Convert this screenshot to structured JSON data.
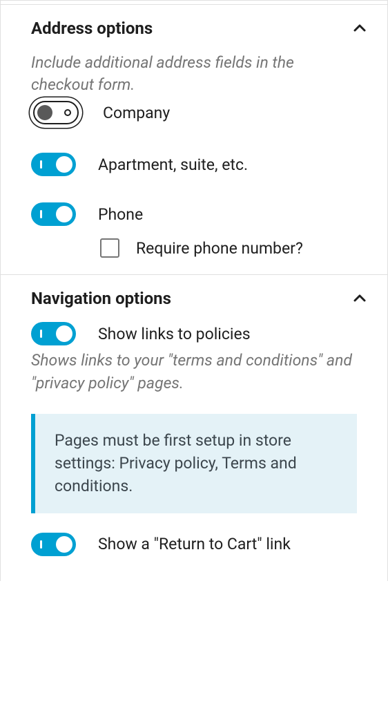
{
  "address_options": {
    "title": "Address options",
    "description": "Include additional address fields in the checkout form.",
    "company": {
      "label": "Company",
      "on": false
    },
    "apartment": {
      "label": "Apartment, suite, etc.",
      "on": true
    },
    "phone": {
      "label": "Phone",
      "on": true
    },
    "require_phone": {
      "label": "Require phone number?",
      "checked": false
    }
  },
  "navigation_options": {
    "title": "Navigation options",
    "policies": {
      "label": "Show links to policies",
      "on": true,
      "help": "Shows links to your \"terms and conditions\" and \"privacy policy\" pages.",
      "notice": "Pages must be first setup in store settings: Privacy policy, Terms and conditions."
    },
    "return_to_cart": {
      "label": "Show a \"Return to Cart\" link",
      "on": true
    }
  }
}
